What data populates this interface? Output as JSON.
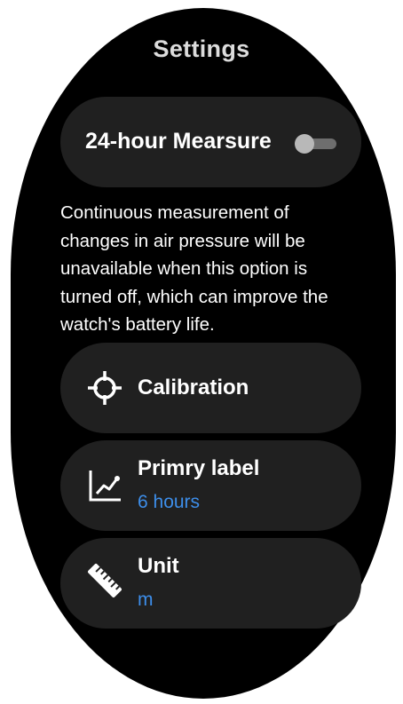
{
  "header": {
    "title": "Settings"
  },
  "measure_toggle": {
    "label": "24-hour Mearsure",
    "enabled": false
  },
  "description": "Continuous measurement of changes in air pressure will be unavailable when this option is turned off, which can improve the watch's battery life.",
  "menu": {
    "calibration": {
      "label": "Calibration",
      "icon": "crosshair-icon"
    },
    "primary_label": {
      "label": "Primry label",
      "value": "6 hours",
      "icon": "line-chart-icon"
    },
    "unit": {
      "label": "Unit",
      "value": "m",
      "icon": "ruler-icon"
    }
  },
  "colors": {
    "background": "#000000",
    "card": "#202020",
    "accent": "#3d8eea",
    "text": "#ffffff"
  }
}
